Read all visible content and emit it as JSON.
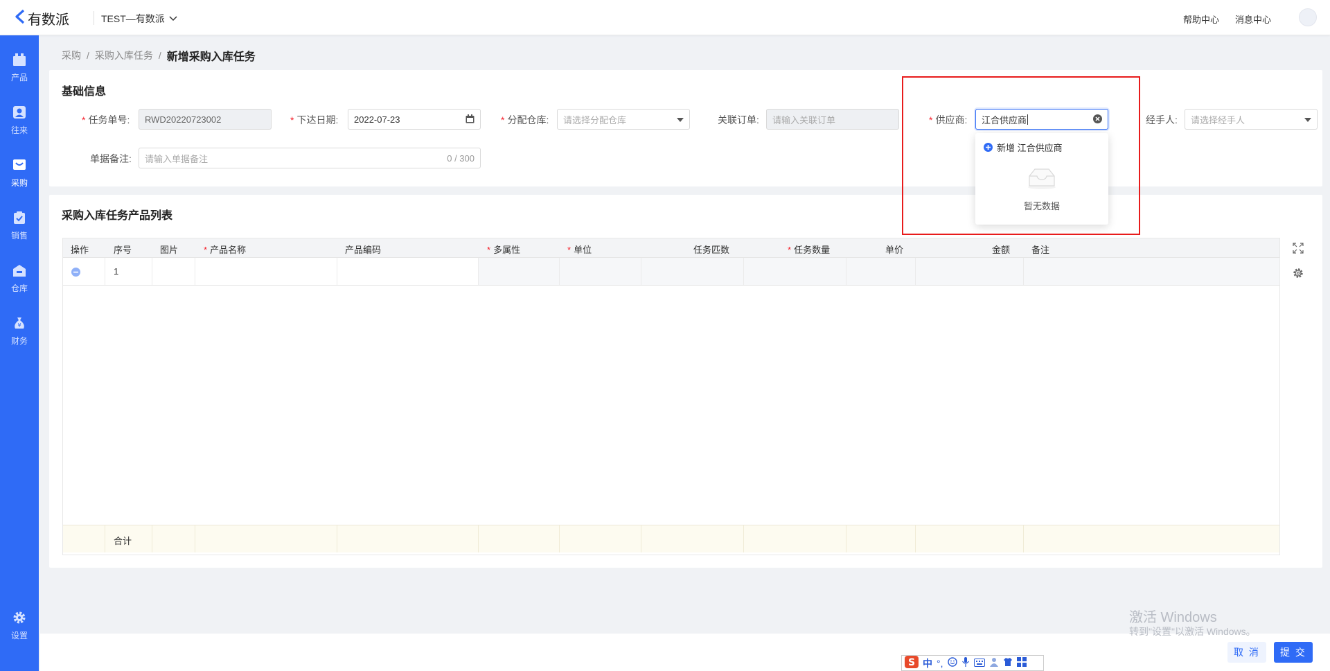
{
  "header": {
    "logo_text": "有数派",
    "org_selector": "TEST—有数派",
    "help_link": "帮助中心",
    "message_link": "消息中心"
  },
  "sidebar": {
    "items": [
      {
        "label": "产品",
        "icon": "box-icon"
      },
      {
        "label": "往来",
        "icon": "contact-icon"
      },
      {
        "label": "采购",
        "icon": "cart-icon",
        "active": true
      },
      {
        "label": "销售",
        "icon": "clipboard-icon"
      },
      {
        "label": "仓库",
        "icon": "warehouse-icon"
      },
      {
        "label": "财务",
        "icon": "money-bag-icon"
      }
    ],
    "settings_label": "设置"
  },
  "breadcrumb": {
    "level1": "采购",
    "level2": "采购入库任务",
    "current": "新增采购入库任务",
    "separator": "/"
  },
  "basic_info": {
    "title": "基础信息",
    "task_no_label": "任务单号:",
    "task_no_value": "RWD20220723002",
    "issue_date_label": "下达日期:",
    "issue_date_value": "2022-07-23",
    "warehouse_label": "分配仓库:",
    "warehouse_placeholder": "请选择分配仓库",
    "linked_order_label": "关联订单:",
    "linked_order_placeholder": "请输入关联订单",
    "supplier_label": "供应商:",
    "supplier_value": "江合供应商",
    "handler_label": "经手人:",
    "handler_placeholder": "请选择经手人",
    "remark_label": "单据备注:",
    "remark_placeholder": "请输入单据备注",
    "remark_counter": "0 / 300"
  },
  "supplier_dropdown": {
    "add_option": "新增 江合供应商",
    "empty_text": "暂无数据"
  },
  "product_list": {
    "title": "采购入库任务产品列表",
    "columns": [
      "操作",
      "序号",
      "图片",
      "产品名称",
      "产品编码",
      "多属性",
      "单位",
      "任务匹数",
      "任务数量",
      "单价",
      "金额",
      "备注"
    ],
    "rows": [
      {
        "index": "1"
      }
    ],
    "total_label": "合计"
  },
  "footer": {
    "cancel_label": "取 消",
    "submit_label": "提 交"
  },
  "watermark": {
    "line1": "激活 Windows",
    "line2": "转到\"设置\"以激活 Windows。"
  },
  "ime": {
    "mode": "中",
    "punct": "°,"
  },
  "colors": {
    "primary": "#2f6bf6",
    "sidebar_bg": "#2f6bf6",
    "highlight_frame": "#e81b1b",
    "required": "#f5222d"
  }
}
